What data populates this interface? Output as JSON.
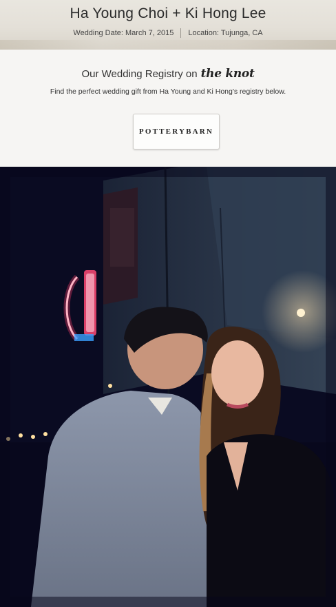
{
  "header": {
    "couple_names": "Ha Young Choi + Ki Hong Lee",
    "wedding_date": "Wedding Date: March 7, 2015",
    "location": "Location: Tujunga, CA"
  },
  "registry": {
    "title": "Our Wedding Registry on",
    "brand_logo": "the knot",
    "subtitle": "Find the perfect wedding gift from Ha Young and Ki Hong's registry below.",
    "store_button": "POTTERYBARN"
  },
  "colors": {
    "header_bg": "#e4e0d8",
    "registry_bg": "#f6f5f3",
    "photo_dark": "#07081a",
    "neon_red": "#ff3b6b"
  }
}
